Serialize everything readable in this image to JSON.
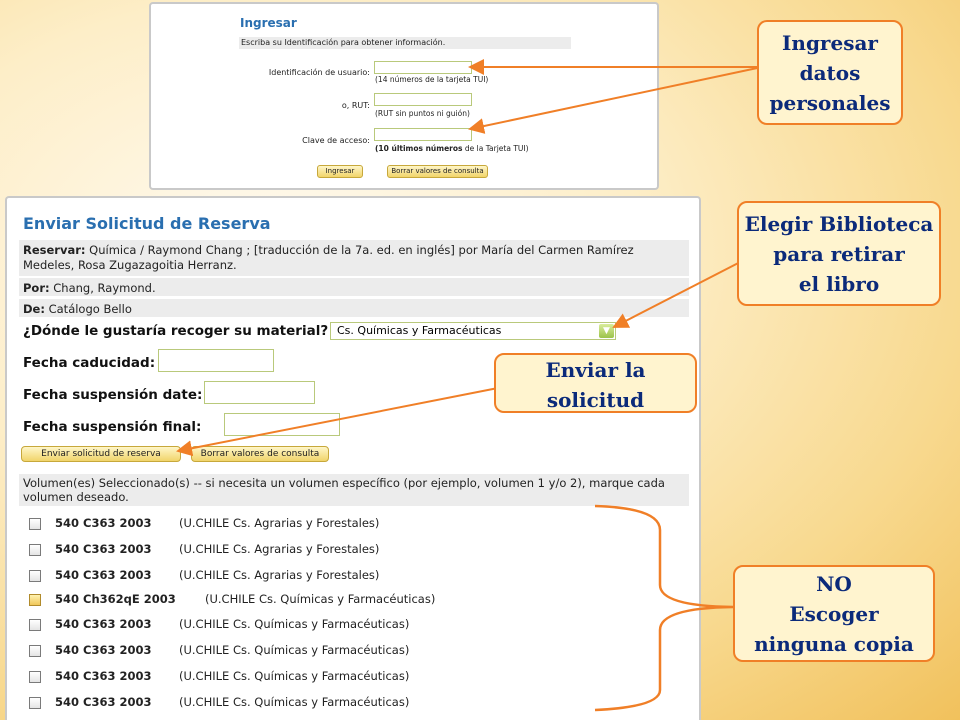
{
  "login": {
    "title": "Ingresar",
    "instructions": "Escriba su Identificación para obtener información.",
    "user_id_label": "Identificación de usuario:",
    "user_id_hint": "(14 números de la tarjeta TUI)",
    "rut_label": "o, RUT:",
    "rut_hint": "(RUT sin puntos ni guión)",
    "password_label": "Clave de acceso:",
    "password_hint_bold": "(10 últimos números",
    "password_hint_rest": " de la Tarjeta TUI)",
    "submit_label": "Ingresar",
    "reset_label": "Borrar valores de consulta"
  },
  "reservation": {
    "title": "Enviar Solicitud de Reserva",
    "reserve_label": "Reservar:",
    "reserve_value": " Química / Raymond Chang ; [traducción de la 7a. ed. en inglés] por María del Carmen Ramírez Medeles, Rosa Zugazagoitia Herranz.",
    "by_label": "Por:",
    "by_value": " Chang, Raymond.",
    "from_label": "De:",
    "from_value": " Catálogo Bello",
    "pickup_question": "¿Dónde le gustaría recoger su material?",
    "pickup_value": "Cs. Químicas y Farmacéuticas",
    "expiry_label": "Fecha caducidad:",
    "suspension_date_label": "Fecha suspensión date:",
    "suspension_final_label": "Fecha suspensión final:",
    "submit_label": "Enviar solicitud de reserva",
    "reset_label": "Borrar valores de consulta",
    "volumes_note": "Volumen(es) Seleccionado(s) -- si necesita un volumen específico (por ejemplo, volumen 1 y/o 2), marque cada volumen deseado.",
    "volumes": [
      {
        "code": "540 C363 2003",
        "library": "(U.CHILE Cs. Agrarias y Forestales)",
        "selected": false
      },
      {
        "code": "540 C363 2003",
        "library": "(U.CHILE Cs. Agrarias y Forestales)",
        "selected": false
      },
      {
        "code": "540 C363 2003",
        "library": "(U.CHILE Cs. Agrarias y Forestales)",
        "selected": false
      },
      {
        "code": "540 Ch362qE 2003",
        "library": "(U.CHILE Cs. Químicas y Farmacéuticas)",
        "selected": true
      },
      {
        "code": "540 C363 2003",
        "library": "(U.CHILE Cs. Químicas y Farmacéuticas)",
        "selected": false
      },
      {
        "code": "540 C363 2003",
        "library": "(U.CHILE Cs. Químicas y Farmacéuticas)",
        "selected": false
      },
      {
        "code": "540 C363 2003",
        "library": "(U.CHILE Cs. Químicas y Farmacéuticas)",
        "selected": false
      },
      {
        "code": "540 C363 2003",
        "library": "(U.CHILE Cs. Químicas y Farmacéuticas)",
        "selected": false
      },
      {
        "code": "540 C363 2003",
        "library": "(U.CHILE Cs. Químicas y Farmacéuticas)",
        "selected": false
      }
    ]
  },
  "callouts": {
    "personal_data": [
      "Ingresar",
      "datos",
      "personales"
    ],
    "choose_library": [
      "Elegir Biblioteca",
      "para retirar",
      "el libro"
    ],
    "send_request": [
      "Enviar la",
      "solicitud"
    ],
    "no_copy": [
      "NO",
      "Escoger",
      "ninguna copia"
    ]
  },
  "colors": {
    "callout_border": "#f07f27",
    "callout_text": "#0b2a7a",
    "title_blue": "#2a6fb0",
    "arrow": "#f07f27"
  }
}
